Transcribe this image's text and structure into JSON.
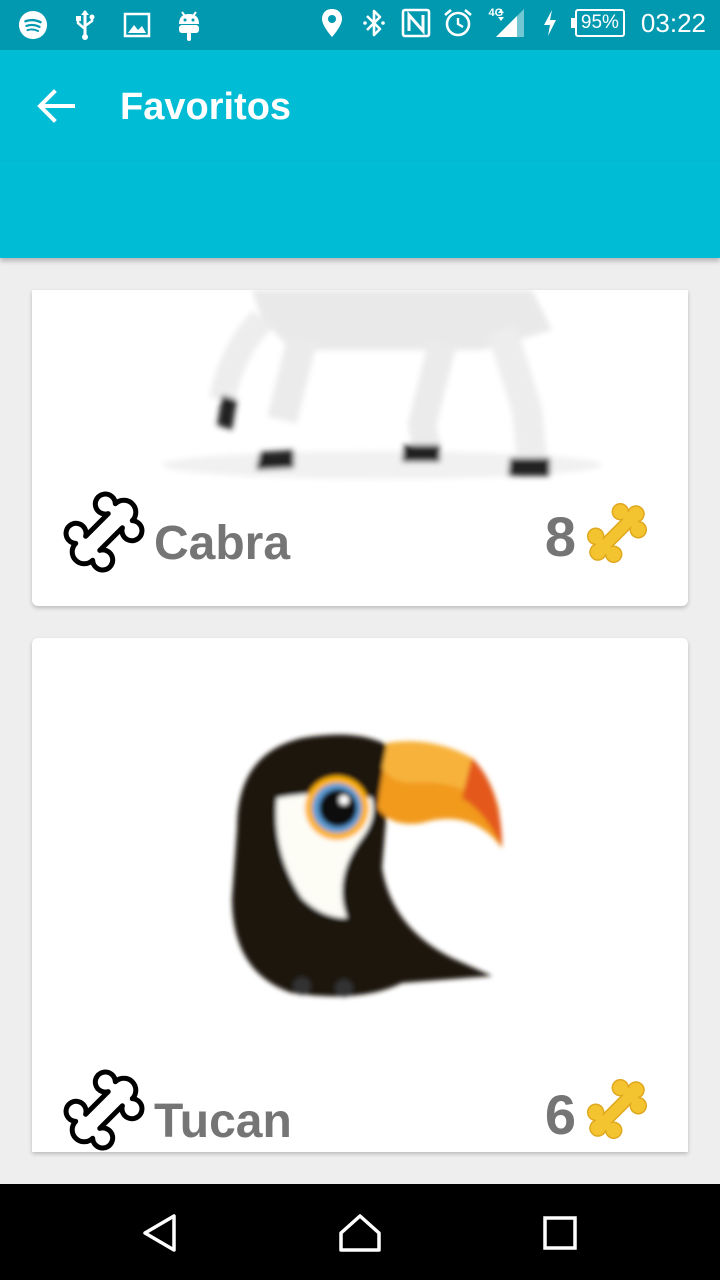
{
  "status_bar": {
    "network_label": "4G",
    "battery": "95%",
    "time": "03:22"
  },
  "app_bar": {
    "title": "Favoritos"
  },
  "favorites": [
    {
      "name": "Cabra",
      "score": "8",
      "image": "goat"
    },
    {
      "name": "Tucan",
      "score": "6",
      "image": "toucan"
    }
  ],
  "colors": {
    "status_bar": "#0099b0",
    "app_bar": "#00bcd4",
    "background": "#eeeeee",
    "text_muted": "#757575",
    "bone_gold": "#f4c430"
  },
  "icons": {
    "status_left": [
      "spotify-icon",
      "usb-icon",
      "image-icon",
      "android-icon"
    ],
    "status_right": [
      "location-icon",
      "bluetooth-icon",
      "nfc-icon",
      "alarm-icon",
      "signal-icon",
      "charging-icon"
    ],
    "navigation": [
      "back-nav-icon",
      "home-nav-icon",
      "recents-nav-icon"
    ]
  }
}
